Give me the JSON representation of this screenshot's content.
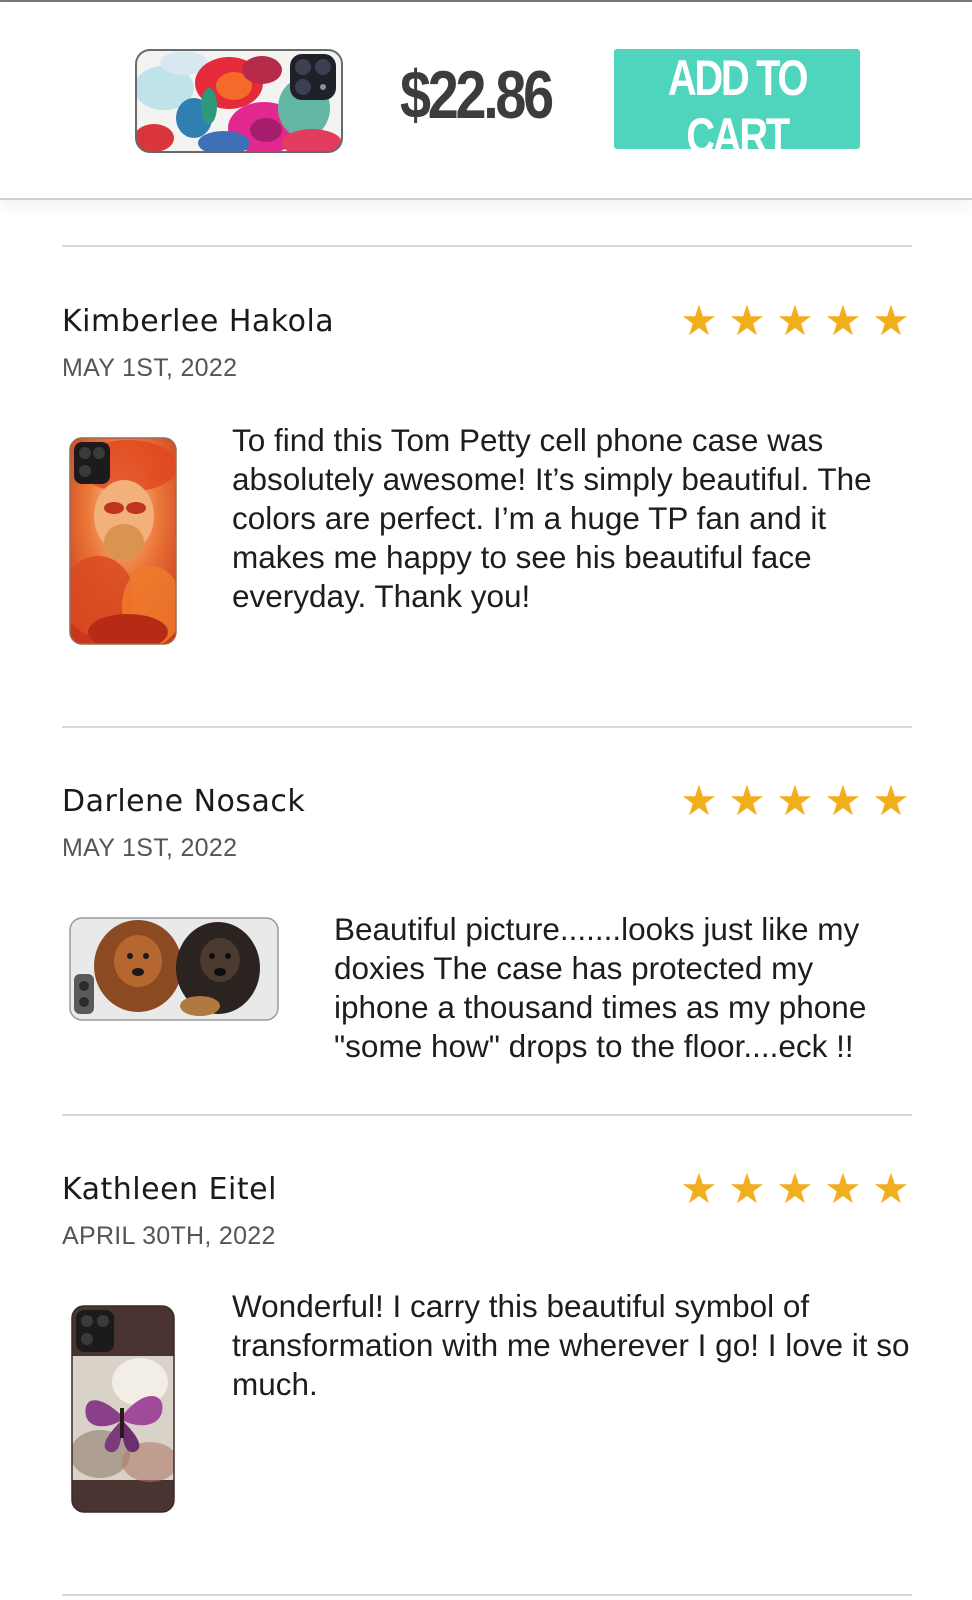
{
  "header": {
    "price": "$22.86",
    "cart_label": "ADD TO CART"
  },
  "reviews": [
    {
      "name": "Kimberlee Hakola",
      "date": "MAY 1ST, 2022",
      "rating": 5,
      "stars": "★",
      "text": "To find this Tom Petty cell phone case was absolutely awesome! It’s simply beautiful. The colors are perfect. I’m a huge TP fan and it makes me happy to see his beautiful face everyday. Thank you!"
    },
    {
      "name": "Darlene Nosack",
      "date": "MAY 1ST, 2022",
      "rating": 5,
      "stars": "★",
      "text": "Beautiful picture.......looks just like my doxies The case has protected my iphone a thousand times as my phone \"some how\" drops to the floor....eck !!"
    },
    {
      "name": "Kathleen Eitel",
      "date": "APRIL 30TH, 2022",
      "rating": 5,
      "stars": "★",
      "text": "Wonderful! I carry this beautiful symbol of transformation with me wherever I go! I love it so much."
    }
  ],
  "colors": {
    "accent": "#4fd4bd",
    "star": "#f2ae1c",
    "price": "#3c3c3c"
  }
}
